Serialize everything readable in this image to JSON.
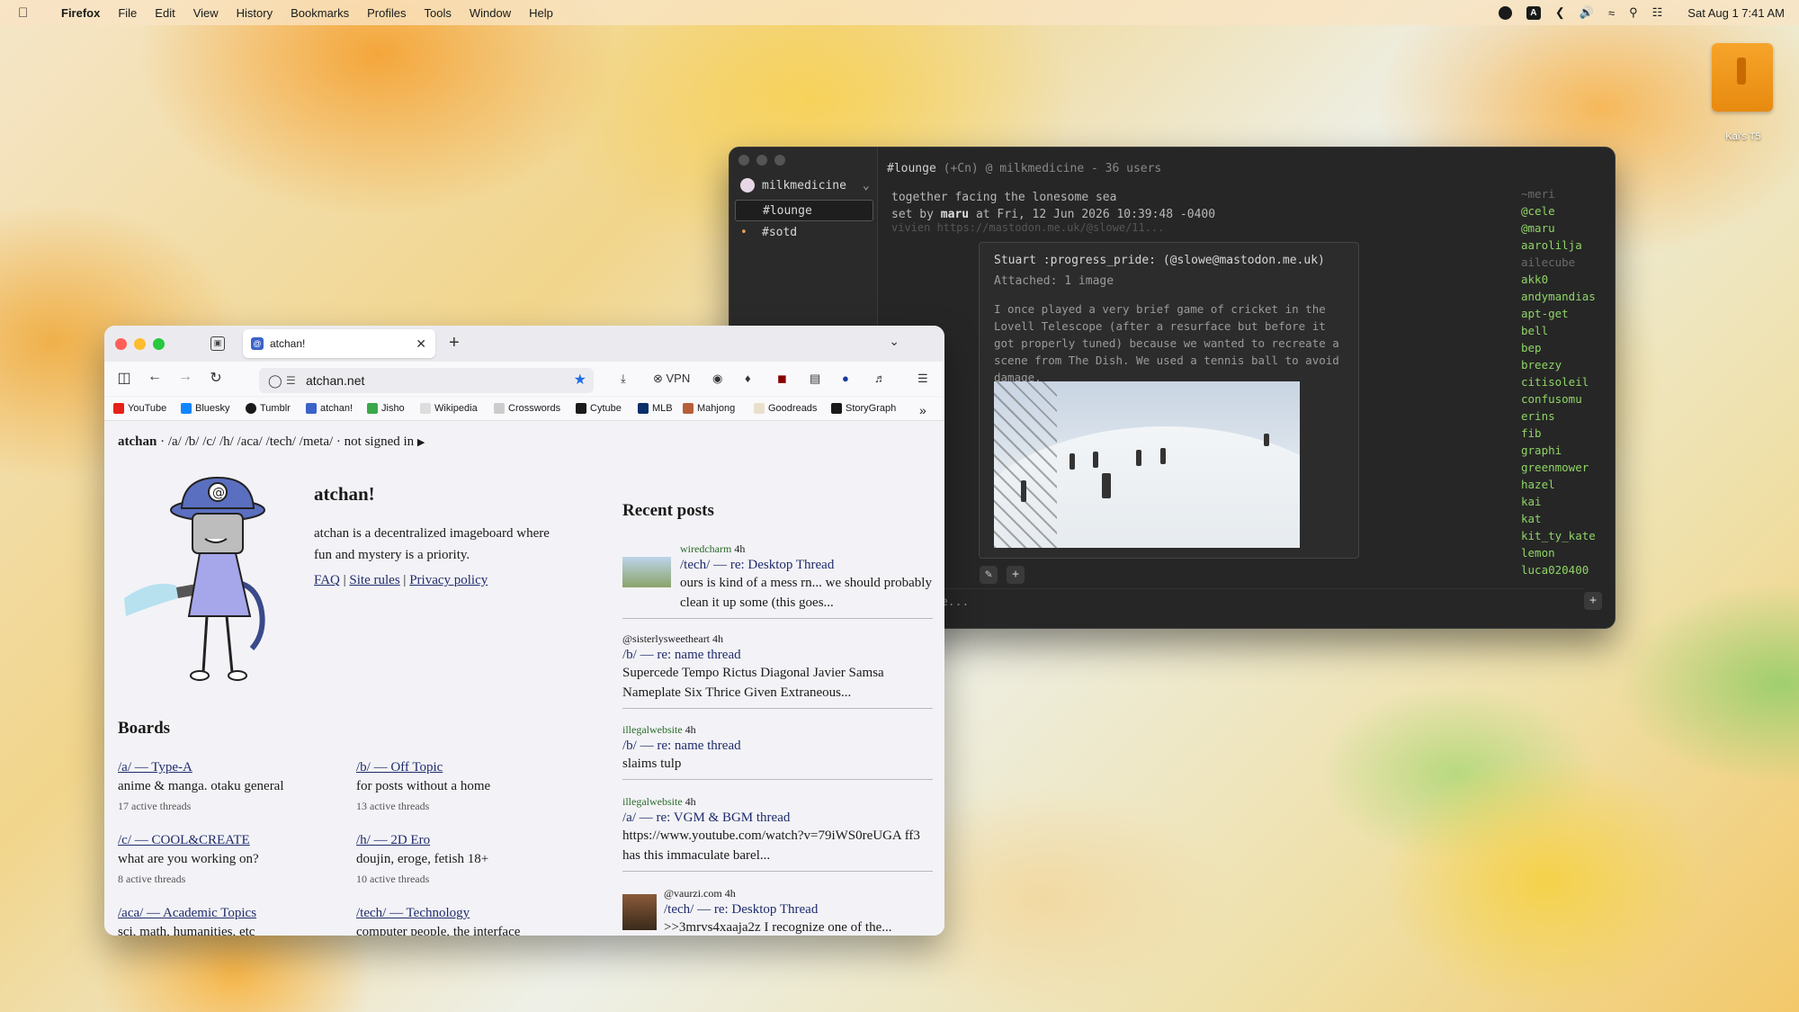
{
  "menubar": {
    "app": "Firefox",
    "items": [
      "File",
      "Edit",
      "View",
      "History",
      "Bookmarks",
      "Profiles",
      "Tools",
      "Window",
      "Help"
    ],
    "status_letter": "A",
    "clock": "Sat Aug 1  7:41 AM"
  },
  "desktop": {
    "disk_label": "Kai's T5"
  },
  "chat": {
    "server": "milkmedicine",
    "channels": [
      "#lounge",
      "#sotd"
    ],
    "topic_channel": "#lounge",
    "topic_meta": "(+Cn) @ milkmedicine - 36 users",
    "topic_text": "together facing the lonesome sea",
    "topic_setby_prefix": "set by",
    "topic_setby_user": "maru",
    "topic_setby_time": "at Fri, 12 Jun 2026 10:39:48 -0400",
    "ghost_line": "vivien https://mastodon.me.uk/@slowe/11...",
    "popup": {
      "author": "Stuart :progress_pride: (@slowe@mastodon.me.uk)",
      "attached": "Attached: 1 image",
      "body": "I once played a very brief game of cricket in the Lovell Telescope (after a resurface but before it got properly tuned) because we wanted to recreate a scene from The Dish. We used a tennis ball to avoid damage."
    },
    "input_placeholder": "message...",
    "users": [
      "~meri",
      "@cele",
      "@maru",
      "aarolilja",
      "ailecube",
      "akk0",
      "andymandias",
      "apt-get",
      "bell",
      "bep",
      "breezy",
      "citisoleil",
      "confusomu",
      "erins",
      "fib",
      "graphi",
      "greenmower",
      "hazel",
      "kai",
      "kat",
      "kit_ty_kate",
      "lemon",
      "luca020400"
    ],
    "users_dim": [
      "~meri",
      "ailecube"
    ]
  },
  "browser": {
    "tab_title": "atchan!",
    "url": "atchan.net",
    "vpn_label": "VPN",
    "bookmarks": [
      "YouTube",
      "Bluesky",
      "Tumblr",
      "atchan!",
      "Jisho",
      "Wikipedia",
      "Crosswords",
      "Cytube",
      "MLB",
      "Mahjong",
      "Goodreads",
      "StoryGraph"
    ],
    "crumb": {
      "site": "atchan",
      "links": [
        "/a/",
        "/b/",
        "/c/",
        "/h/",
        "/aca/",
        "/tech/",
        "/meta/"
      ],
      "status": "· not signed in"
    },
    "intro": {
      "title": "atchan!",
      "text": "atchan is a decentralized imageboard where fun and mystery is a priority.",
      "faq": "FAQ",
      "rules": "Site rules",
      "privacy": "Privacy policy"
    },
    "boards_heading": "Boards",
    "boards": [
      {
        "title": "/a/ — Type-A",
        "desc": "anime & manga. otaku general",
        "count": "17 active threads"
      },
      {
        "title": "/b/ — Off Topic",
        "desc": "for posts without a home",
        "count": "13 active threads"
      },
      {
        "title": "/c/ — COOL&CREATE",
        "desc": "what are you working on?",
        "count": "8 active threads"
      },
      {
        "title": "/h/ — 2D Ero",
        "desc": "doujin, eroge, fetish 18+",
        "count": "10 active threads"
      },
      {
        "title": "/aca/ — Academic Topics",
        "desc": "sci, math, humanities, etc",
        "count": ""
      },
      {
        "title": "/tech/ — Technology",
        "desc": "computer people, the interface",
        "count": ""
      }
    ],
    "recent_heading": "Recent posts",
    "posts": [
      {
        "user": "wiredcharm",
        "age": "4h",
        "title": "/tech/ — re: Desktop Thread",
        "text": "ours is kind of a mess rn... we should probably clean it up some (this goes..."
      },
      {
        "user": "@sisterlysweetheart",
        "age": "4h",
        "title": "/b/ — re: name thread",
        "text": "Supercede Tempo Rictus Diagonal Javier Samsa Nameplate Six Thrice Given Extraneous..."
      },
      {
        "user": "illegalwebsite",
        "age": "4h",
        "title": "/b/ — re: name thread",
        "text": "slaims tulp"
      },
      {
        "user": "illegalwebsite",
        "age": "4h",
        "title": "/a/ — re: VGM & BGM thread",
        "text": "https://www.youtube.com/watch?v=79iWS0reUGA ff3 has this immaculate barel..."
      },
      {
        "user": "@vaurzi.com",
        "age": "4h",
        "title": "/tech/ — re: Desktop Thread",
        "text": ">>3mrvs4xaaja2z I recognize one of the..."
      }
    ]
  }
}
